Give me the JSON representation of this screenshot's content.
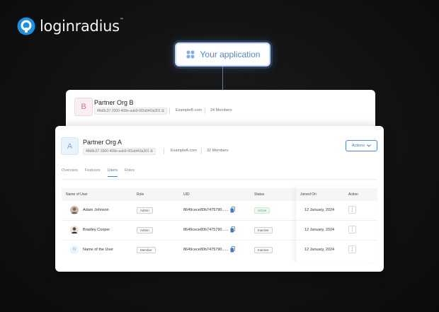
{
  "brand": {
    "name": "loginradius",
    "trademark": "™",
    "color": "#1b8fe0"
  },
  "app": {
    "label": "Your application",
    "icon": "apps-icon",
    "accent": "#4f86cf"
  },
  "org_b": {
    "initial": "B",
    "name": "Partner Org B",
    "id": "48d8c37-3300-408e-aab9-6f2abf43a301",
    "domain": "ExampleB.com",
    "members": "24 Members"
  },
  "org_a": {
    "initial": "A",
    "name": "Partner Org A",
    "id": "48d8c37-3300-408e-aab9-6f2abf43a301",
    "domain": "ExampleA.com",
    "members": "32 Members",
    "actions_label": "Actions"
  },
  "tabs": [
    {
      "label": "Overview",
      "active": false
    },
    {
      "label": "Features",
      "active": false
    },
    {
      "label": "Users",
      "active": true
    },
    {
      "label": "Roles",
      "active": false
    }
  ],
  "table": {
    "headers": [
      "Name of User",
      "Role",
      "UID",
      "Status",
      "Joined On",
      "Action"
    ],
    "rows": [
      {
        "name": "Adam Johnson",
        "role": "Admin",
        "uid": "8649cece80b7475790......",
        "status": "Active",
        "joined": "12 January, 2024"
      },
      {
        "name": "Bradley Cooper",
        "role": "Admin",
        "uid": "8649cece80b7475790......",
        "status": "Inactive",
        "joined": "12 January, 2024"
      },
      {
        "name": "Name of the User",
        "role": "Member",
        "uid": "8649cece80b7475790......",
        "status": "Inactive",
        "joined": "12 January, 2024"
      }
    ],
    "third_row_initial": "N"
  }
}
